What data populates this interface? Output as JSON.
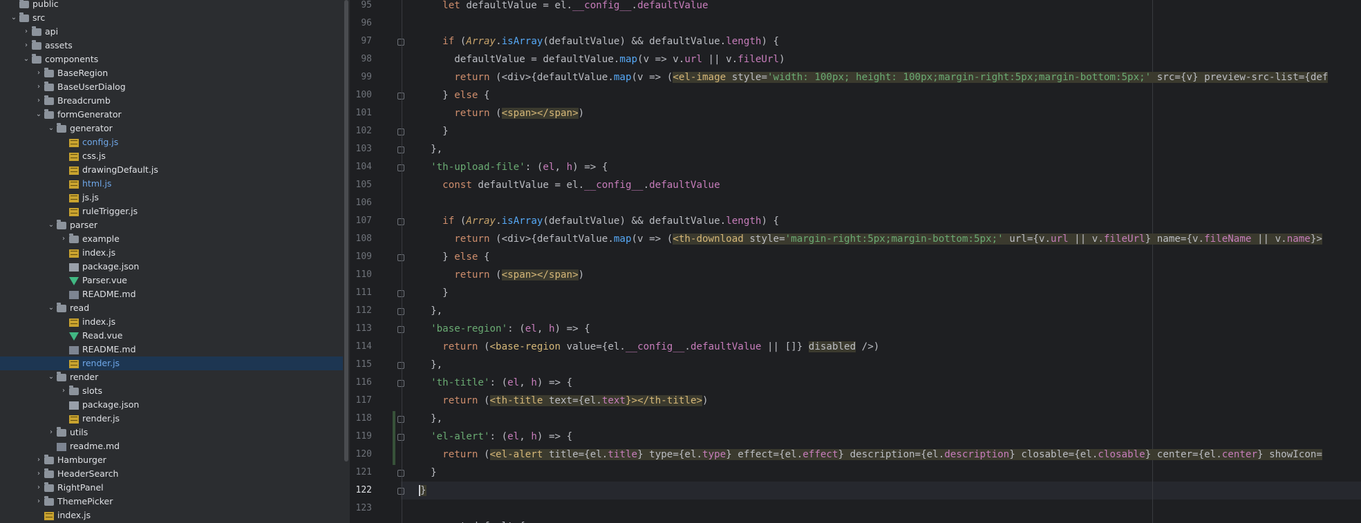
{
  "tree": {
    "items": [
      {
        "label": "public",
        "type": "folder",
        "depth": 0,
        "arrow": ""
      },
      {
        "label": "src",
        "type": "folder",
        "depth": 0,
        "arrow": "open"
      },
      {
        "label": "api",
        "type": "folder",
        "depth": 1,
        "arrow": "closed"
      },
      {
        "label": "assets",
        "type": "folder",
        "depth": 1,
        "arrow": "closed"
      },
      {
        "label": "components",
        "type": "folder",
        "depth": 1,
        "arrow": "open"
      },
      {
        "label": "BaseRegion",
        "type": "folder",
        "depth": 2,
        "arrow": "closed"
      },
      {
        "label": "BaseUserDialog",
        "type": "folder",
        "depth": 2,
        "arrow": "closed"
      },
      {
        "label": "Breadcrumb",
        "type": "folder",
        "depth": 2,
        "arrow": "closed"
      },
      {
        "label": "formGenerator",
        "type": "folder",
        "depth": 2,
        "arrow": "open"
      },
      {
        "label": "generator",
        "type": "folder",
        "depth": 3,
        "arrow": "open"
      },
      {
        "label": "config.js",
        "type": "js",
        "depth": 4,
        "arrow": "",
        "blue": true
      },
      {
        "label": "css.js",
        "type": "js",
        "depth": 4,
        "arrow": ""
      },
      {
        "label": "drawingDefault.js",
        "type": "js",
        "depth": 4,
        "arrow": ""
      },
      {
        "label": "html.js",
        "type": "js",
        "depth": 4,
        "arrow": "",
        "blue": true
      },
      {
        "label": "js.js",
        "type": "js",
        "depth": 4,
        "arrow": ""
      },
      {
        "label": "ruleTrigger.js",
        "type": "js",
        "depth": 4,
        "arrow": ""
      },
      {
        "label": "parser",
        "type": "folder",
        "depth": 3,
        "arrow": "open"
      },
      {
        "label": "example",
        "type": "folder",
        "depth": 4,
        "arrow": "closed"
      },
      {
        "label": "index.js",
        "type": "js",
        "depth": 4,
        "arrow": ""
      },
      {
        "label": "package.json",
        "type": "json",
        "depth": 4,
        "arrow": ""
      },
      {
        "label": "Parser.vue",
        "type": "vue",
        "depth": 4,
        "arrow": ""
      },
      {
        "label": "README.md",
        "type": "md",
        "depth": 4,
        "arrow": ""
      },
      {
        "label": "read",
        "type": "folder",
        "depth": 3,
        "arrow": "open"
      },
      {
        "label": "index.js",
        "type": "js",
        "depth": 4,
        "arrow": ""
      },
      {
        "label": "Read.vue",
        "type": "vue",
        "depth": 4,
        "arrow": ""
      },
      {
        "label": "README.md",
        "type": "md",
        "depth": 4,
        "arrow": ""
      },
      {
        "label": "render.js",
        "type": "js",
        "depth": 4,
        "arrow": "",
        "blue": true,
        "selected": true
      },
      {
        "label": "render",
        "type": "folder",
        "depth": 3,
        "arrow": "open"
      },
      {
        "label": "slots",
        "type": "folder",
        "depth": 4,
        "arrow": "closed"
      },
      {
        "label": "package.json",
        "type": "json",
        "depth": 4,
        "arrow": ""
      },
      {
        "label": "render.js",
        "type": "js",
        "depth": 4,
        "arrow": ""
      },
      {
        "label": "utils",
        "type": "folder",
        "depth": 3,
        "arrow": "closed"
      },
      {
        "label": "readme.md",
        "type": "md",
        "depth": 3,
        "arrow": ""
      },
      {
        "label": "Hamburger",
        "type": "folder",
        "depth": 2,
        "arrow": "closed"
      },
      {
        "label": "HeaderSearch",
        "type": "folder",
        "depth": 2,
        "arrow": "closed"
      },
      {
        "label": "RightPanel",
        "type": "folder",
        "depth": 2,
        "arrow": "closed"
      },
      {
        "label": "ThemePicker",
        "type": "folder",
        "depth": 2,
        "arrow": "closed"
      },
      {
        "label": "index.js",
        "type": "js",
        "depth": 2,
        "arrow": ""
      }
    ]
  },
  "editor": {
    "current_line": "122",
    "lines": [
      {
        "n": "95",
        "fold": false,
        "tokens": [
          [
            "    ",
            ""
          ],
          [
            "let ",
            "kw"
          ],
          [
            "defaultValue = el.",
            ""
          ],
          [
            "__config__",
            "prop"
          ],
          [
            ".",
            ""
          ],
          [
            "defaultValue",
            "prop"
          ]
        ]
      },
      {
        "n": "96",
        "fold": false,
        "tokens": []
      },
      {
        "n": "97",
        "fold": true,
        "tokens": [
          [
            "    ",
            ""
          ],
          [
            "if ",
            "kw"
          ],
          [
            "(",
            ""
          ],
          [
            "Array",
            "cls"
          ],
          [
            ".",
            ""
          ],
          [
            "isArray",
            "fn"
          ],
          [
            "(defaultValue) && defaultValue.",
            ""
          ],
          [
            "length",
            "prop"
          ],
          [
            ") {",
            ""
          ]
        ]
      },
      {
        "n": "98",
        "fold": false,
        "tokens": [
          [
            "      defaultValue = defaultValue.",
            ""
          ],
          [
            "map",
            "fn"
          ],
          [
            "(v => v.",
            ""
          ],
          [
            "url",
            "prop"
          ],
          [
            " || v.",
            ""
          ],
          [
            "fileUrl",
            "prop"
          ],
          [
            ")",
            ""
          ]
        ]
      },
      {
        "n": "99",
        "fold": false,
        "tokens": [
          [
            "      ",
            ""
          ],
          [
            "return ",
            "kw"
          ],
          [
            "(<div>{defaultValue.",
            ""
          ],
          [
            "map",
            "fn"
          ],
          [
            "(v => (",
            ""
          ],
          [
            "<el-image ",
            "tag jsx"
          ],
          [
            "style=",
            "attr jsx"
          ],
          [
            "'width: 100px; height: 100px;margin-right:5px;margin-bottom:5px;'",
            "str jsx"
          ],
          [
            " src={v} preview-src-list={def",
            "attr jsx"
          ]
        ]
      },
      {
        "n": "100",
        "fold": true,
        "tokens": [
          [
            "    } ",
            ""
          ],
          [
            "else ",
            "kw"
          ],
          [
            "{",
            ""
          ]
        ]
      },
      {
        "n": "101",
        "fold": false,
        "tokens": [
          [
            "      ",
            ""
          ],
          [
            "return ",
            "kw"
          ],
          [
            "(",
            ""
          ],
          [
            "<span></span>",
            "tag jsx"
          ],
          [
            ")",
            ""
          ]
        ]
      },
      {
        "n": "102",
        "fold": true,
        "tokens": [
          [
            "    }",
            ""
          ]
        ]
      },
      {
        "n": "103",
        "fold": true,
        "tokens": [
          [
            "  },",
            ""
          ]
        ]
      },
      {
        "n": "104",
        "fold": true,
        "tokens": [
          [
            "  ",
            ""
          ],
          [
            "'th-upload-file'",
            "str"
          ],
          [
            ": (",
            ""
          ],
          [
            "el",
            "prop"
          ],
          [
            ", ",
            ""
          ],
          [
            "h",
            "prop"
          ],
          [
            ") => {",
            ""
          ]
        ]
      },
      {
        "n": "105",
        "fold": false,
        "tokens": [
          [
            "    ",
            ""
          ],
          [
            "const ",
            "kw"
          ],
          [
            "defaultValue = el.",
            ""
          ],
          [
            "__config__",
            "prop"
          ],
          [
            ".",
            ""
          ],
          [
            "defaultValue",
            "prop"
          ]
        ]
      },
      {
        "n": "106",
        "fold": false,
        "tokens": []
      },
      {
        "n": "107",
        "fold": true,
        "tokens": [
          [
            "    ",
            ""
          ],
          [
            "if ",
            "kw"
          ],
          [
            "(",
            ""
          ],
          [
            "Array",
            "cls"
          ],
          [
            ".",
            ""
          ],
          [
            "isArray",
            "fn"
          ],
          [
            "(defaultValue) && defaultValue.",
            ""
          ],
          [
            "length",
            "prop"
          ],
          [
            ") {",
            ""
          ]
        ]
      },
      {
        "n": "108",
        "fold": false,
        "tokens": [
          [
            "      ",
            ""
          ],
          [
            "return ",
            "kw"
          ],
          [
            "(<div>{defaultValue.",
            ""
          ],
          [
            "map",
            "fn"
          ],
          [
            "(v => (",
            ""
          ],
          [
            "<th-download ",
            "tag jsx"
          ],
          [
            "style=",
            "attr jsx"
          ],
          [
            "'margin-right:5px;margin-bottom:5px;'",
            "str jsx"
          ],
          [
            " url={v.",
            "attr jsx"
          ],
          [
            "url",
            "prop jsx"
          ],
          [
            " || v.",
            "attr jsx"
          ],
          [
            "fileUrl",
            "prop jsx"
          ],
          [
            "} name={v.",
            "attr jsx"
          ],
          [
            "fileName",
            "prop jsx"
          ],
          [
            " || v.",
            "attr jsx"
          ],
          [
            "name",
            "prop jsx"
          ],
          [
            "}>",
            "attr jsx"
          ]
        ]
      },
      {
        "n": "109",
        "fold": true,
        "tokens": [
          [
            "    } ",
            ""
          ],
          [
            "else ",
            "kw"
          ],
          [
            "{",
            ""
          ]
        ]
      },
      {
        "n": "110",
        "fold": false,
        "tokens": [
          [
            "      ",
            ""
          ],
          [
            "return ",
            "kw"
          ],
          [
            "(",
            ""
          ],
          [
            "<span></span>",
            "tag jsx"
          ],
          [
            ")",
            ""
          ]
        ]
      },
      {
        "n": "111",
        "fold": true,
        "tokens": [
          [
            "    }",
            ""
          ]
        ]
      },
      {
        "n": "112",
        "fold": true,
        "tokens": [
          [
            "  },",
            ""
          ]
        ]
      },
      {
        "n": "113",
        "fold": true,
        "tokens": [
          [
            "  ",
            ""
          ],
          [
            "'base-region'",
            "str"
          ],
          [
            ": (",
            ""
          ],
          [
            "el",
            "prop"
          ],
          [
            ", ",
            ""
          ],
          [
            "h",
            "prop"
          ],
          [
            ") => {",
            ""
          ]
        ]
      },
      {
        "n": "114",
        "fold": false,
        "tokens": [
          [
            "    ",
            ""
          ],
          [
            "return ",
            "kw"
          ],
          [
            "(",
            ""
          ],
          [
            "<base-region ",
            "tag"
          ],
          [
            "value={el.",
            ""
          ],
          [
            "__config__",
            "prop"
          ],
          [
            ".",
            ""
          ],
          [
            "defaultValue",
            "prop"
          ],
          [
            " || []} ",
            ""
          ],
          [
            "disabled",
            "attr jsx"
          ],
          [
            " />",
            ""
          ],
          [
            ")",
            ""
          ]
        ]
      },
      {
        "n": "115",
        "fold": true,
        "tokens": [
          [
            "  },",
            ""
          ]
        ]
      },
      {
        "n": "116",
        "fold": true,
        "tokens": [
          [
            "  ",
            ""
          ],
          [
            "'th-title'",
            "str"
          ],
          [
            ": (",
            ""
          ],
          [
            "el",
            "prop"
          ],
          [
            ", ",
            ""
          ],
          [
            "h",
            "prop"
          ],
          [
            ") => {",
            ""
          ]
        ]
      },
      {
        "n": "117",
        "fold": false,
        "tokens": [
          [
            "    ",
            ""
          ],
          [
            "return ",
            "kw"
          ],
          [
            "(",
            ""
          ],
          [
            "<th-title ",
            "tag jsx"
          ],
          [
            "text={el.",
            "attr jsx"
          ],
          [
            "text",
            "prop jsx"
          ],
          [
            "}></th-title>",
            "tag jsx"
          ],
          [
            ")",
            ""
          ]
        ]
      },
      {
        "n": "118",
        "fold": true,
        "tokens": [
          [
            "  },",
            ""
          ]
        ]
      },
      {
        "n": "119",
        "fold": true,
        "tokens": [
          [
            "  ",
            ""
          ],
          [
            "'el-alert'",
            "str"
          ],
          [
            ": (",
            ""
          ],
          [
            "el",
            "prop"
          ],
          [
            ", ",
            ""
          ],
          [
            "h",
            "prop"
          ],
          [
            ") => {",
            ""
          ]
        ]
      },
      {
        "n": "120",
        "fold": false,
        "tokens": [
          [
            "    ",
            ""
          ],
          [
            "return ",
            "kw"
          ],
          [
            "(",
            ""
          ],
          [
            "<el-alert ",
            "tag jsx"
          ],
          [
            "title={el.",
            "attr jsx"
          ],
          [
            "title",
            "prop jsx"
          ],
          [
            "} type={el.",
            "attr jsx"
          ],
          [
            "type",
            "prop jsx"
          ],
          [
            "} effect={el.",
            "attr jsx"
          ],
          [
            "effect",
            "prop jsx"
          ],
          [
            "} description={el.",
            "attr jsx"
          ],
          [
            "description",
            "prop jsx"
          ],
          [
            "} closable={el.",
            "attr jsx"
          ],
          [
            "closable",
            "prop jsx"
          ],
          [
            "} center={el.",
            "attr jsx"
          ],
          [
            "center",
            "prop jsx"
          ],
          [
            "} showIcon=",
            "attr jsx"
          ]
        ]
      },
      {
        "n": "121",
        "fold": true,
        "tokens": [
          [
            "  }",
            ""
          ]
        ]
      },
      {
        "n": "122",
        "fold": true,
        "tokens": [
          [
            "}",
            "jsx"
          ]
        ],
        "caret": true
      },
      {
        "n": "123",
        "fold": false,
        "tokens": []
      },
      {
        "n": "",
        "fold": false,
        "tokens": [
          [
            "  export default {",
            ""
          ]
        ]
      }
    ]
  }
}
